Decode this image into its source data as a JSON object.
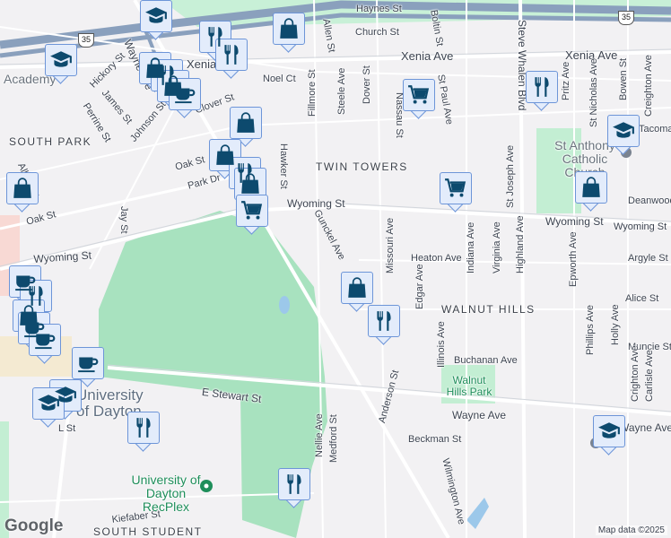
{
  "map": {
    "attribution": "Map data ©2025",
    "logo": "Google",
    "highway_shields": [
      "35",
      "35"
    ],
    "colors": {
      "background": "#f2f1f3",
      "park": "#a8e2bf",
      "road": "#ffffff",
      "road_edge": "#d2d6dc",
      "highway": "#8aa0bd",
      "marker_fill": "#e3ecfb",
      "marker_border": "#6d95d8",
      "icon": "#0d4a6e"
    },
    "districts": [
      "SOUTH PARK",
      "TWIN TOWERS",
      "WALNUT HILLS",
      "SOUTH STUDENT"
    ],
    "places": [
      "Academy",
      "St Anthony Catholic Church",
      "University of Dayton",
      "University of Dayton RecPlex",
      "Walnut Hills Park"
    ],
    "streets": [
      "Haynes St",
      "Church St",
      "Xenia Ave",
      "Xenia Ave",
      "Xenia",
      "Noel Ct",
      "Clover St",
      "Hickory St",
      "James St",
      "Perrine St",
      "Johnson St",
      "Oak St",
      "Park Dr",
      "Oak St",
      "Jay St",
      "Wyoming St",
      "Wyoming St",
      "Wyoming St",
      "Hawker St",
      "Fillmore St",
      "Allen St",
      "Steele Ave",
      "Dover St",
      "Nassau St",
      "Boltin St",
      "St Paul Ave",
      "St Joseph Ave",
      "Steve Whalen Blvd",
      "Pritz Ave",
      "St Nicholas Ave",
      "Bowen St",
      "Creighton Ave",
      "Tacoma",
      "Deanwood",
      "Gunckel Ave",
      "Missouri Ave",
      "Indiana Ave",
      "Virginia Ave",
      "Highland Ave",
      "Epworth Ave",
      "Heaton Ave",
      "Argyle St",
      "Edgar Ave",
      "Alice St",
      "Phillips Ave",
      "Holly Ave",
      "Muncie St",
      "Buchanan Ave",
      "Illinois Ave",
      "Crighton Ave",
      "Carlisle Ave",
      "E Stewart St",
      "Wayne Ave",
      "Wayne Ave",
      "Anderson St",
      "Nellie Ave",
      "Medford St",
      "Beckman St",
      "Wilmington Ave",
      "L St",
      "Kiefaber St",
      "Wayne Ave",
      "Albert St",
      "Wyoming St"
    ],
    "markers": [
      "school",
      "school",
      "restaurant",
      "restaurant",
      "shopping",
      "coffee",
      "shopping",
      "shopping",
      "restaurant",
      "shopping",
      "grocery",
      "grocery",
      "restaurant",
      "school",
      "shopping",
      "grocery",
      "shopping",
      "shopping",
      "restaurant",
      "coffee",
      "coffee",
      "school",
      "restaurant",
      "restaurant",
      "school",
      "coffee"
    ]
  }
}
